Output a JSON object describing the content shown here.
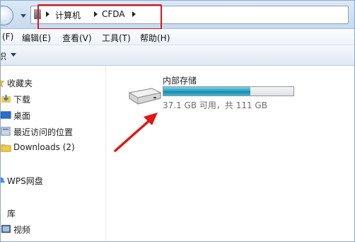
{
  "address": {
    "crumbs": [
      "计算机",
      "CFDA"
    ]
  },
  "menu": {
    "items": [
      "(F)",
      "编辑(E)",
      "查看(V)",
      "工具(T)",
      "帮助(H)"
    ]
  },
  "toolbar": {
    "organize_label": "织"
  },
  "nav": {
    "items": [
      {
        "label": "收藏夹",
        "icon": "star-icon"
      },
      {
        "label": "下载",
        "icon": "download-folder-icon"
      },
      {
        "label": "桌面",
        "icon": "desktop-icon"
      },
      {
        "label": "最近访问的位置",
        "icon": "recent-places-icon"
      },
      {
        "label": "Downloads (2)",
        "icon": "folder-icon"
      },
      {
        "label": "WPS网盘",
        "icon": "cloud-drive-icon"
      },
      {
        "label": "库",
        "icon": "library-icon"
      },
      {
        "label": "视频",
        "icon": "video-icon"
      }
    ]
  },
  "drive": {
    "name": "内部存储",
    "info": "37.1 GB 可用，共 111 GB",
    "used_fraction": 0.67
  },
  "colors": {
    "annotation": "#e01515",
    "bar_fill": "#2aa3c4"
  }
}
